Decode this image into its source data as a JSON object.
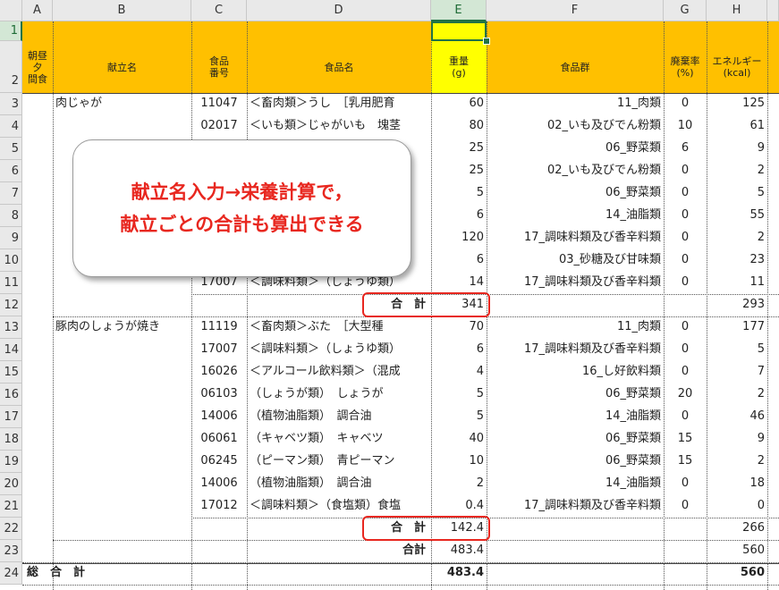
{
  "columns": [
    "A",
    "B",
    "C",
    "D",
    "E",
    "F",
    "G",
    "H"
  ],
  "selected_cell": "E1",
  "header": {
    "col_a": [
      "朝昼",
      "夕",
      "間食"
    ],
    "col_b": "献立名",
    "col_c": [
      "食品",
      "番号"
    ],
    "col_d": "食品名",
    "col_e": [
      "重量",
      "(g)"
    ],
    "col_f": "食品群",
    "col_g": [
      "廃棄率",
      "(%)"
    ],
    "col_h": [
      "エネルギー",
      "(kcal)"
    ]
  },
  "callout": {
    "line1": "献立名入力→栄養計算で，",
    "line2": "献立ごとの合計も算出できる"
  },
  "rows": [
    {
      "n": "3",
      "b": "肉じゃが",
      "c": "11047",
      "d": "＜畜肉類＞うし　［乳用肥育",
      "e": "60",
      "f": "11_肉類",
      "g": "0",
      "h": "125"
    },
    {
      "n": "4",
      "b": "",
      "c": "02017",
      "d": "＜いも類＞じゃがいも　塊茎",
      "e": "80",
      "f": "02_いも及びでん粉類",
      "g": "10",
      "h": "61"
    },
    {
      "n": "5",
      "b": "",
      "c": "",
      "d": "",
      "e": "25",
      "f": "06_野菜類",
      "g": "6",
      "h": "9"
    },
    {
      "n": "6",
      "b": "",
      "c": "",
      "d": "",
      "e": "25",
      "f": "02_いも及びでん粉類",
      "g": "0",
      "h": "2"
    },
    {
      "n": "7",
      "b": "",
      "c": "",
      "d": "",
      "e": "5",
      "f": "06_野菜類",
      "g": "0",
      "h": "5"
    },
    {
      "n": "8",
      "b": "",
      "c": "",
      "d": "",
      "e": "6",
      "f": "14_油脂類",
      "g": "0",
      "h": "55"
    },
    {
      "n": "9",
      "b": "",
      "c": "",
      "d": "",
      "e": "120",
      "f": "17_調味料類及び香辛料類",
      "g": "0",
      "h": "2"
    },
    {
      "n": "10",
      "b": "",
      "c": "",
      "d": "",
      "e": "6",
      "f": "03_砂糖及び甘味類",
      "g": "0",
      "h": "23"
    },
    {
      "n": "11",
      "b": "",
      "c": "17007",
      "d": "＜調味料類＞（しょうゆ類）",
      "e": "14",
      "f": "17_調味料類及び香辛料類",
      "g": "0",
      "h": "11"
    },
    {
      "n": "12",
      "b": "",
      "c": "",
      "d": "合　計",
      "e": "341",
      "f": "",
      "g": "",
      "h": "293"
    },
    {
      "n": "13",
      "b": "豚肉のしょうが焼き",
      "c": "11119",
      "d": "＜畜肉類＞ぶた　［大型種",
      "e": "70",
      "f": "11_肉類",
      "g": "0",
      "h": "177"
    },
    {
      "n": "14",
      "b": "",
      "c": "17007",
      "d": "＜調味料類＞（しょうゆ類）",
      "e": "6",
      "f": "17_調味料類及び香辛料類",
      "g": "0",
      "h": "5"
    },
    {
      "n": "15",
      "b": "",
      "c": "16026",
      "d": "＜アルコール飲料類＞（混成",
      "e": "4",
      "f": "16_し好飲料類",
      "g": "0",
      "h": "7"
    },
    {
      "n": "16",
      "b": "",
      "c": "06103",
      "d": "（しょうが類）　しょうが",
      "e": "5",
      "f": "06_野菜類",
      "g": "20",
      "h": "2"
    },
    {
      "n": "17",
      "b": "",
      "c": "14006",
      "d": "（植物油脂類）　調合油",
      "e": "5",
      "f": "14_油脂類",
      "g": "0",
      "h": "46"
    },
    {
      "n": "18",
      "b": "",
      "c": "06061",
      "d": "（キャベツ類）　キャベツ",
      "e": "40",
      "f": "06_野菜類",
      "g": "15",
      "h": "9"
    },
    {
      "n": "19",
      "b": "",
      "c": "06245",
      "d": "（ピーマン類）　青ピーマン",
      "e": "10",
      "f": "06_野菜類",
      "g": "15",
      "h": "2"
    },
    {
      "n": "20",
      "b": "",
      "c": "14006",
      "d": "（植物油脂類）　調合油",
      "e": "2",
      "f": "14_油脂類",
      "g": "0",
      "h": "18"
    },
    {
      "n": "21",
      "b": "",
      "c": "17012",
      "d": "＜調味料類＞（食塩類）食塩",
      "e": "0.4",
      "f": "17_調味料類及び香辛料類",
      "g": "0",
      "h": "0"
    },
    {
      "n": "22",
      "b": "",
      "c": "",
      "d": "合　計",
      "e": "142.4",
      "f": "",
      "g": "",
      "h": "266"
    },
    {
      "n": "23",
      "b": "",
      "c": "",
      "d": "合計",
      "e": "483.4",
      "f": "",
      "g": "",
      "h": "560"
    },
    {
      "n": "24",
      "b": "総　合　計",
      "c": "",
      "d": "",
      "e": "483.4",
      "f": "",
      "g": "",
      "h": "560"
    }
  ],
  "row_labels": [
    "1",
    "2"
  ]
}
